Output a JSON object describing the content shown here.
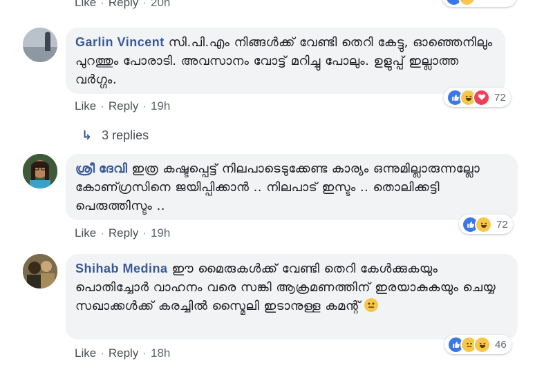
{
  "top_actions": {
    "like": "Like",
    "reply": "Reply",
    "time": "20h"
  },
  "comments": [
    {
      "author": "Garlin Vincent",
      "text": "സി.പി.എം നിങ്ങൾക്ക് വേണ്ടി തെറി കേട്ടു, ഓഞ്ഞെനിലും പുറത്തും പോരാടി. അവസാനം വോട്ട് മറിച്ചു പോലും. ഉളുപ്പ് ഇല്ലാത്ത വർഗ്ഗം.",
      "like": "Like",
      "reply": "Reply",
      "time": "19h",
      "reaction_count": "72",
      "reactions": [
        "like-icon",
        "haha-icon",
        "love-icon"
      ],
      "replies_label": "3 replies"
    },
    {
      "author": "ശ്രീ ദേവി",
      "text": "ഇത്ര കഷ്ടപ്പെട്ട് നിലപാടെടുക്കേണ്ട കാര്യം ഒന്നുമില്ലാരുന്നല്ലോ കോണ്ഗ്രസിനെ ജയിപ്പിക്കാൻ .. നിലപാട് ഇസ്ടം .. തൊലിക്കട്ടി പെരുത്തിസ്ടം ..",
      "like": "Like",
      "reply": "Reply",
      "time": "19h",
      "reaction_count": "72",
      "reactions": [
        "like-icon",
        "haha-icon"
      ]
    },
    {
      "author": "Shihab Medina",
      "text": "ഈ മൈരുകൾക്ക് വേണ്ടി തെറി കേൾക്കുകയും പൊതിച്ചോർ വാഹനം വരെ സങ്കി ആക്രമണത്തിന് ഇരയാകുകയും ചെയ്യ സഖാക്കൾക്ക് കരച്ചിൽ സ്മൈലി ഇടാനുള്ള കമന്റ്",
      "like": "Like",
      "reply": "Reply",
      "time": "18h",
      "reaction_count": "46",
      "reactions": [
        "like-icon",
        "sad-icon",
        "haha-icon"
      ]
    }
  ],
  "colors": {
    "link": "#385898",
    "bubble": "#f2f3f5",
    "meta": "#606770"
  }
}
